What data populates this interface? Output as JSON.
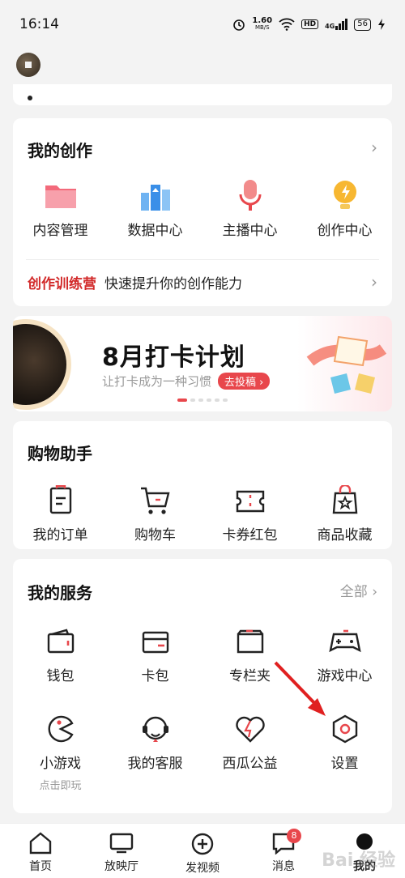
{
  "status": {
    "time": "16:14",
    "speed": "1.60",
    "speed_unit": "MB/S",
    "hd": "HD",
    "network": "4G",
    "battery": "56"
  },
  "creation": {
    "title": "我的创作",
    "items": [
      {
        "label": "内容管理",
        "icon": "folder-icon"
      },
      {
        "label": "数据中心",
        "icon": "bar-chart-icon"
      },
      {
        "label": "主播中心",
        "icon": "microphone-icon"
      },
      {
        "label": "创作中心",
        "icon": "lightbulb-icon"
      }
    ],
    "promo_highlight": "创作训练营",
    "promo_text": "快速提升你的创作能力"
  },
  "banner": {
    "title": "8月打卡计划",
    "subtitle": "让打卡成为一种习惯",
    "button": "去投稿",
    "active_slide": 1,
    "slide_count": 6
  },
  "shopping": {
    "title": "购物助手",
    "items": [
      {
        "label": "我的订单",
        "icon": "order-icon"
      },
      {
        "label": "购物车",
        "icon": "cart-icon"
      },
      {
        "label": "卡券红包",
        "icon": "coupon-icon"
      },
      {
        "label": "商品收藏",
        "icon": "favorite-bag-icon"
      }
    ]
  },
  "services": {
    "title": "我的服务",
    "all_label": "全部",
    "items": [
      {
        "label": "钱包",
        "icon": "wallet-icon"
      },
      {
        "label": "卡包",
        "icon": "card-icon"
      },
      {
        "label": "专栏夹",
        "icon": "column-folder-icon"
      },
      {
        "label": "游戏中心",
        "icon": "gamepad-icon"
      },
      {
        "label": "小游戏",
        "sublabel": "点击即玩",
        "icon": "mini-game-icon"
      },
      {
        "label": "我的客服",
        "icon": "headset-icon"
      },
      {
        "label": "西瓜公益",
        "icon": "heart-icon"
      },
      {
        "label": "设置",
        "icon": "gear-hex-icon"
      }
    ]
  },
  "tabs": [
    {
      "label": "首页",
      "icon": "home-icon"
    },
    {
      "label": "放映厅",
      "icon": "tv-icon"
    },
    {
      "label": "发视频",
      "icon": "plus-circle-icon"
    },
    {
      "label": "消息",
      "icon": "message-icon",
      "badge": "8"
    },
    {
      "label": "我的",
      "icon": "profile-icon"
    }
  ],
  "watermark": "Bai 经验",
  "colors": {
    "accent": "#e8474c",
    "promo": "#d22a2a"
  }
}
